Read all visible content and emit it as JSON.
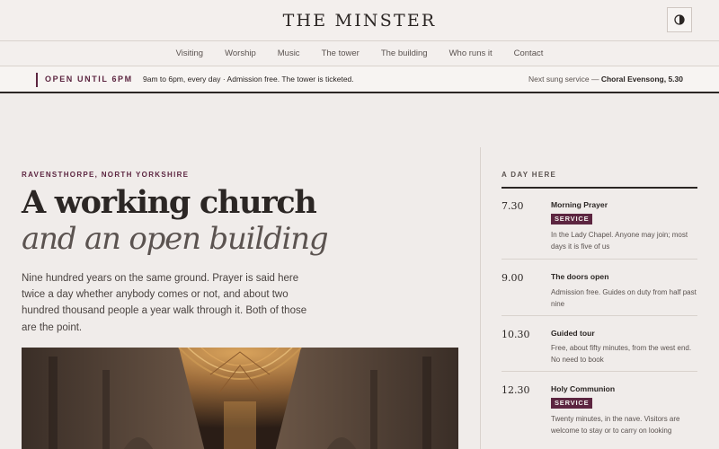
{
  "header": {
    "brand": "THE MINSTER",
    "theme_toggle_icon": "contrast-icon"
  },
  "nav": {
    "items": [
      "Visiting",
      "Worship",
      "Music",
      "The tower",
      "The building",
      "Who runs it",
      "Contact"
    ]
  },
  "notice": {
    "status": "OPEN UNTIL 6PM",
    "hours": "9am to 6pm, every day · Admission free. The tower is ticketed.",
    "next_prefix": "Next sung service —",
    "next_service": "Choral Evensong, 5.30"
  },
  "hero": {
    "location": "RAVENSTHORPE, NORTH YORKSHIRE",
    "heading_line1": "A working church",
    "heading_line2": "and an open building",
    "intro": "Nine hundred years on the same ground. Prayer is said here twice a day whether anybody comes or not, and about two hundred thousand people a year walk through it. Both of those are the point."
  },
  "schedule": {
    "heading": "A DAY HERE",
    "entries": [
      {
        "time": "7.30",
        "title": "Morning Prayer",
        "badge": "SERVICE",
        "desc": "In the Lady Chapel. Anyone may join; most days it is five of us"
      },
      {
        "time": "9.00",
        "title": "The doors open",
        "badge": "",
        "desc": "Admission free. Guides on duty from half past nine"
      },
      {
        "time": "10.30",
        "title": "Guided tour",
        "badge": "",
        "desc": "Free, about fifty minutes, from the west end. No need to book"
      },
      {
        "time": "12.30",
        "title": "Holy Communion",
        "badge": "SERVICE",
        "desc": "Twenty minutes, in the nave. Visitors are welcome to stay or to carry on looking"
      }
    ]
  },
  "colors": {
    "background": "#f0ecea",
    "accent": "#5c2540",
    "text": "#2b2624"
  }
}
